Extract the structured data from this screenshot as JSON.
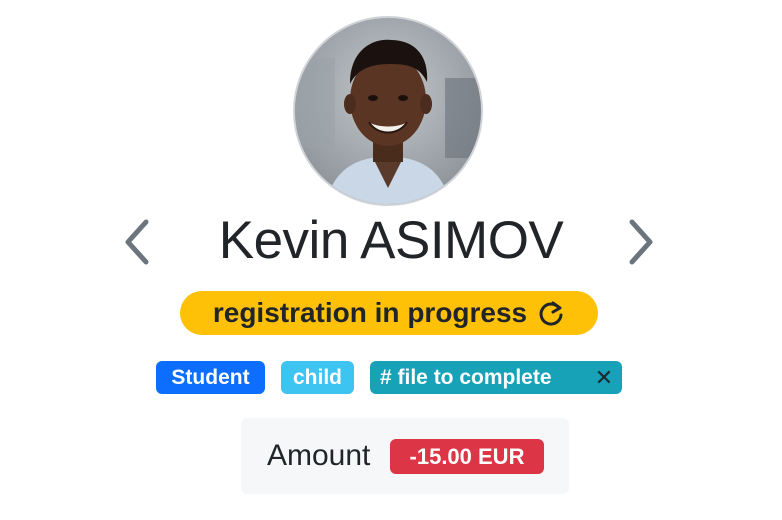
{
  "profile": {
    "name": "Kevin ASIMOV",
    "avatar_icon": "profile-photo"
  },
  "navigation": {
    "prev_icon": "chevron-left-icon",
    "next_icon": "chevron-right-icon"
  },
  "status": {
    "label": "registration in progress",
    "icon": "refresh-icon",
    "color": "#ffc107"
  },
  "tags": [
    {
      "label": "Student",
      "color": "#0d6efd"
    },
    {
      "label": "child",
      "color": "#3dc4f0"
    },
    {
      "label": "# file to complete",
      "color": "#17a2b8",
      "remove_icon": "close-icon"
    }
  ],
  "amount": {
    "label": "Amount",
    "value": "-15.00 EUR",
    "color": "#dc3545"
  }
}
